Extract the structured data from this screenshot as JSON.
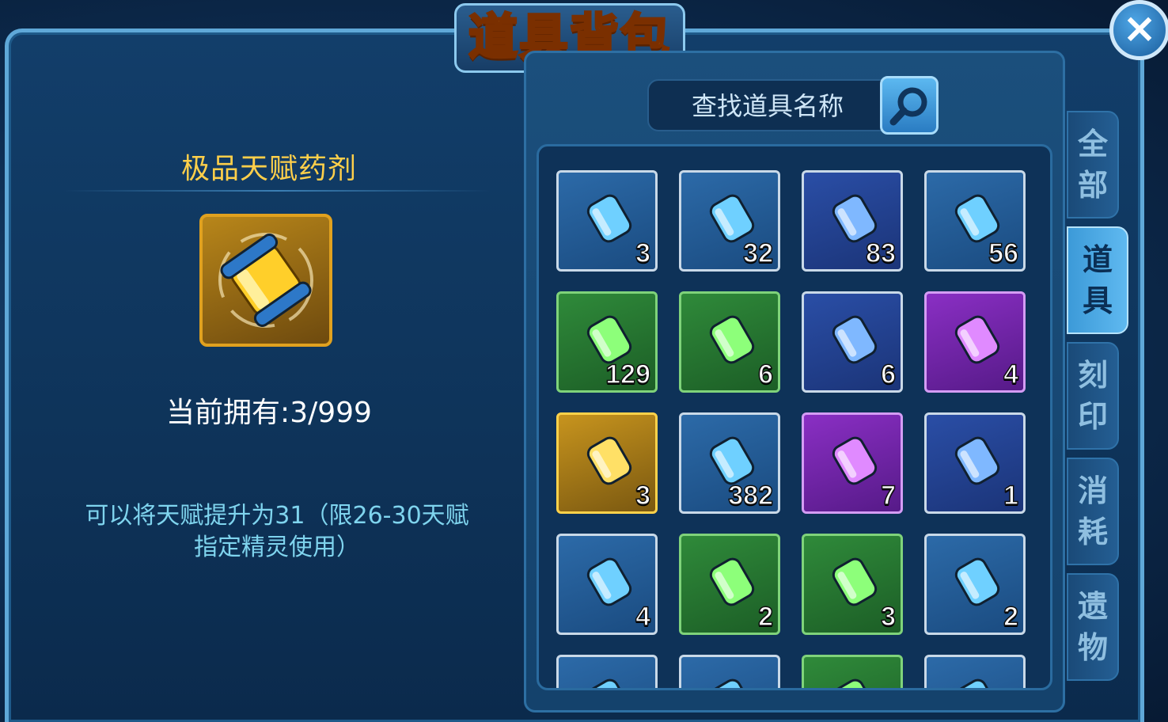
{
  "window": {
    "title": "道具背包",
    "close_label": "×"
  },
  "detail": {
    "name": "极品天赋药剂",
    "owned_label": "当前拥有:",
    "owned_value": "3/999",
    "description_line1": "可以将天赋提升为31（限26-30天赋",
    "description_line2": "指定精灵使用）"
  },
  "search": {
    "placeholder": "查找道具名称"
  },
  "tabs": [
    {
      "label": "全部",
      "active": false
    },
    {
      "label": "道具",
      "active": true
    },
    {
      "label": "刻印",
      "active": false
    },
    {
      "label": "消耗",
      "active": false
    },
    {
      "label": "遗物",
      "active": false
    }
  ],
  "items": [
    {
      "icon": "rainbow-crystal-wing-icon",
      "count": "3",
      "style": "blue"
    },
    {
      "icon": "orange-crystal-pedestal-icon",
      "count": "32",
      "style": "blue"
    },
    {
      "icon": "circuit-chip-icon",
      "count": "83",
      "style": "navy"
    },
    {
      "icon": "green-canister-pair-icon",
      "count": "56",
      "style": "blue"
    },
    {
      "icon": "blue-capsule-orb-icon",
      "count": "129",
      "style": "green"
    },
    {
      "icon": "green-potion-tube-icon",
      "count": "6",
      "style": "green"
    },
    {
      "icon": "blue-potion-tube-icon",
      "count": "6",
      "style": "navy"
    },
    {
      "icon": "purple-potion-tube-icon",
      "count": "4",
      "style": "purple"
    },
    {
      "icon": "gold-potion-tube-icon",
      "count": "3",
      "style": "gold"
    },
    {
      "icon": "blue-sphere-icon",
      "count": "382",
      "style": "blue"
    },
    {
      "icon": "rainbow-potion-tube-icon",
      "count": "7",
      "style": "purple"
    },
    {
      "icon": "shield-emblem-plate-icon",
      "count": "1",
      "style": "navy"
    },
    {
      "icon": "gold-diamond-gem-icon",
      "count": "4",
      "style": "blue"
    },
    {
      "icon": "red-fire-crystal-icon",
      "count": "2",
      "style": "green"
    },
    {
      "icon": "dark-ore-rock-icon",
      "count": "3",
      "style": "green"
    },
    {
      "icon": "ice-cube-circuit-icon",
      "count": "2",
      "style": "blue"
    },
    {
      "icon": "partial-item-icon",
      "count": "",
      "style": "blue"
    },
    {
      "icon": "partial-item-icon",
      "count": "",
      "style": "blue"
    },
    {
      "icon": "partial-item-icon",
      "count": "",
      "style": "green"
    },
    {
      "icon": "partial-item-icon",
      "count": "",
      "style": "blue"
    }
  ],
  "colors": {
    "title": "#ffd23a",
    "detail_name": "#ffcf4a",
    "description": "#7fd4ee",
    "panel_bg": "#14426c"
  }
}
